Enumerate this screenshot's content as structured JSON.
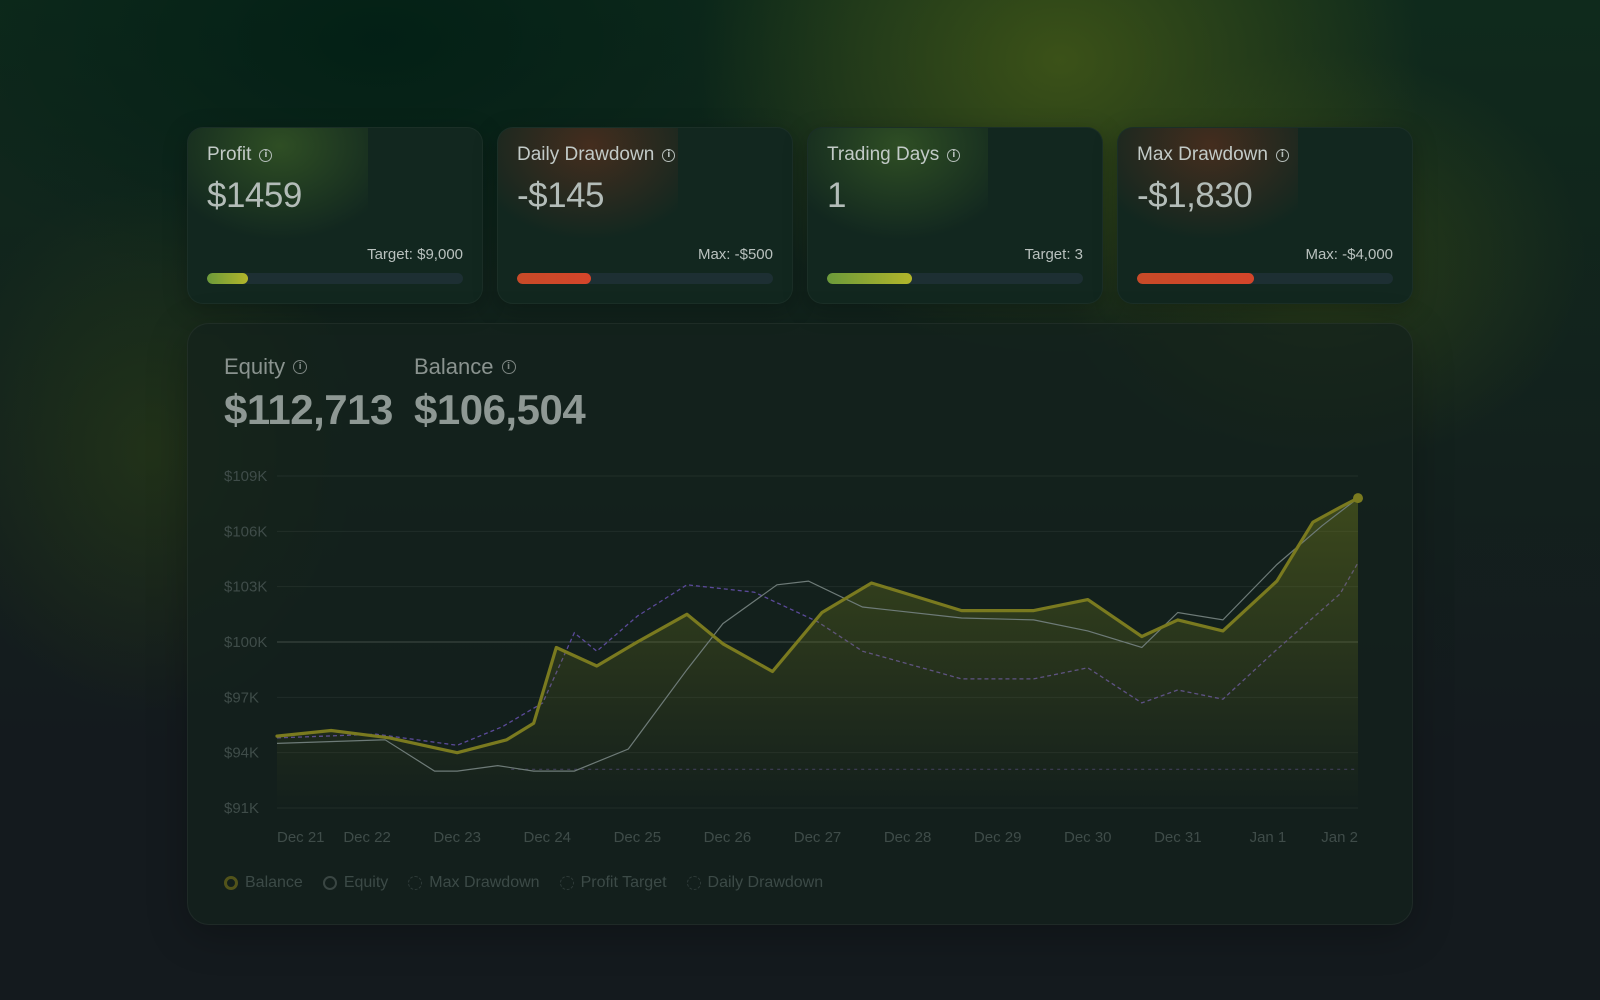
{
  "cards": [
    {
      "label": "Profit",
      "value": "$1459",
      "limit_text": "Target: $9,000",
      "progress": 0.162,
      "tone": "green"
    },
    {
      "label": "Daily Drawdown",
      "value": "-$145",
      "limit_text": "Max: -$500",
      "progress": 0.29,
      "tone": "red"
    },
    {
      "label": "Trading Days",
      "value": "1",
      "limit_text": "Target: 3",
      "progress": 0.333,
      "tone": "green"
    },
    {
      "label": "Max Drawdown",
      "value": "-$1,830",
      "limit_text": "Max: -$4,000",
      "progress": 0.4575,
      "tone": "red"
    }
  ],
  "stats": {
    "equity": {
      "label": "Equity",
      "value": "$112,713"
    },
    "balance": {
      "label": "Balance",
      "value": "$106,504"
    }
  },
  "legend": [
    "Balance",
    "Equity",
    "Max Drawdown",
    "Profit Target",
    "Daily Drawdown"
  ],
  "colors": {
    "balance": "#7a7a1f",
    "equity": "#6e7b78",
    "max_drawdown": "#5b4a9a",
    "profit_target": "#3d3a5a",
    "accent_green": "#b2b52a",
    "accent_red": "#d4452a"
  },
  "chart_data": {
    "type": "line",
    "x_categories": [
      "Dec 21",
      "Dec 22",
      "Dec 23",
      "Dec 24",
      "Dec 25",
      "Dec 26",
      "Dec 27",
      "Dec 28",
      "Dec 29",
      "Dec 30",
      "Dec 31",
      "Jan 1",
      "Jan 2"
    ],
    "y_ticks": [
      "$109K",
      "$106K",
      "$103K",
      "$100K",
      "$97K",
      "$94K",
      "$91K"
    ],
    "ylim": [
      91000,
      109000
    ],
    "grid": true,
    "reference_line": 100000,
    "series": [
      {
        "name": "Balance",
        "x": [
          0,
          0.6,
          1.25,
          2.0,
          2.55,
          2.85,
          3.1,
          3.55,
          4.0,
          4.55,
          4.95,
          5.5,
          6.05,
          6.6,
          7.0,
          7.6,
          8.4,
          9.0,
          9.6,
          10.0,
          10.5,
          11.1,
          11.5,
          11.8,
          12.0
        ],
        "y": [
          94900,
          95200,
          94800,
          94000,
          94700,
          95600,
          99700,
          98700,
          100000,
          101500,
          99900,
          98400,
          101600,
          103200,
          102600,
          101700,
          101700,
          102300,
          100300,
          101200,
          100600,
          103300,
          106500,
          107300,
          107800
        ]
      },
      {
        "name": "Equity",
        "x": [
          0,
          1.2,
          1.75,
          2.0,
          2.45,
          2.85,
          3.3,
          3.9,
          4.55,
          4.95,
          5.55,
          5.9,
          6.5,
          7.6,
          8.4,
          9.0,
          9.6,
          10.0,
          10.5,
          11.1,
          11.6,
          12.0
        ],
        "y": [
          94500,
          94700,
          93000,
          93000,
          93300,
          93000,
          93000,
          94200,
          98500,
          101000,
          103100,
          103300,
          101900,
          101300,
          101200,
          100600,
          99700,
          101600,
          101200,
          104200,
          106300,
          107800
        ]
      },
      {
        "name": "Max Drawdown",
        "x": [
          0,
          1.1,
          2.0,
          2.5,
          2.95,
          3.3,
          3.55,
          4.0,
          4.55,
          5.3,
          6.0,
          6.5,
          7.6,
          8.4,
          9.0,
          9.6,
          10.0,
          10.5,
          11.1,
          11.8,
          12.0
        ],
        "y": [
          94800,
          95000,
          94400,
          95400,
          96700,
          100500,
          99500,
          101400,
          103100,
          102700,
          101100,
          99500,
          98000,
          98000,
          98600,
          96700,
          97400,
          96900,
          99600,
          102600,
          104300
        ]
      },
      {
        "name": "Profit Target",
        "x": [
          2.6,
          12.0
        ],
        "y": [
          93100,
          93100
        ]
      }
    ]
  }
}
